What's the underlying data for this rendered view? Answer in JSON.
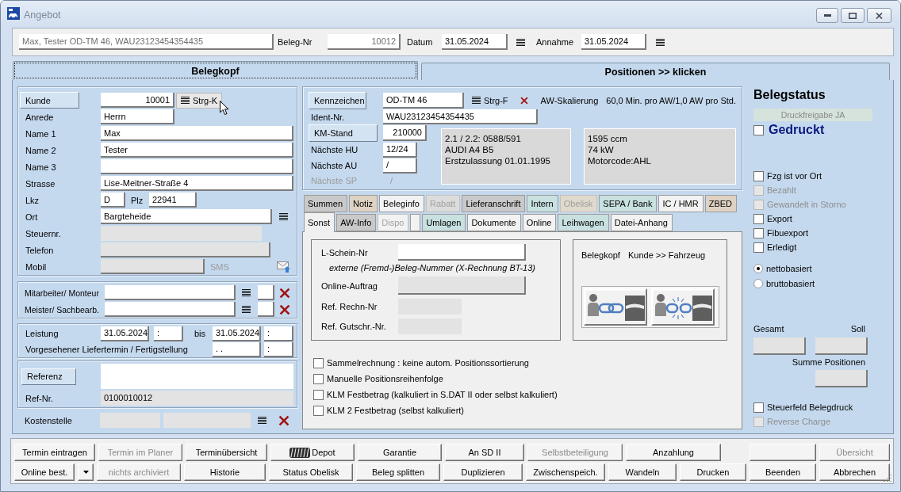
{
  "window": {
    "title": "Angebot"
  },
  "header": {
    "summary": {
      "value": "Max, Tester OD-TM 46, WAU23123454354435",
      "disabled": true
    },
    "beleg_nr": {
      "label": "Beleg-Nr",
      "value": "10012",
      "disabled": true
    },
    "datum": {
      "label": "Datum",
      "value": "31.05.2024"
    },
    "annahme": {
      "label": "Annahme",
      "value": "31.05.2024"
    }
  },
  "main_tabs": [
    {
      "label": "Belegkopf",
      "selected": true
    },
    {
      "label": "Positionen >> klicken",
      "selected": false
    }
  ],
  "customer": {
    "kunde": {
      "button": "Kunde",
      "value": "10001",
      "shortcut": "Strg-K"
    },
    "anrede": {
      "label": "Anrede",
      "value": "Herrn"
    },
    "name_1": {
      "label": "Name 1",
      "value": "Max"
    },
    "name_2": {
      "label": "Name 2",
      "value": "Tester"
    },
    "name_3": {
      "label": "Name 3"
    },
    "strasse": {
      "label": "Strasse",
      "value": "Lise-Meitner-Straße 4"
    },
    "lkz": {
      "label": "Lkz",
      "value": "D"
    },
    "plz": {
      "label": "Plz",
      "value": "22941"
    },
    "ort": {
      "label": "Ort",
      "value": "Bargteheide"
    },
    "steuernr": {
      "label": "Steuernr.",
      "disabled": true
    },
    "telefon": {
      "label": "Telefon",
      "disabled": true
    },
    "mobil": {
      "label": "Mobil",
      "disabled": true,
      "sms": "SMS"
    }
  },
  "staff": [
    {
      "label": "Mitarbeiter/ Monteur"
    },
    {
      "label": "Meister/ Sachbearb."
    }
  ],
  "schedule": {
    "leistung": {
      "label": "Leistung",
      "date": "31.05.2024",
      "time": ":"
    },
    "bis": {
      "label": "bis",
      "date": "31.05.2024",
      "time": ":"
    },
    "liefertermin": {
      "label": "Vorgesehener Liefertermin / Fertigstellung",
      "date": ". .",
      "time": ":"
    }
  },
  "reference": {
    "button": "Referenz",
    "ref_nr": {
      "label": "Ref-Nr.",
      "value": "0100010012",
      "disabled": true
    }
  },
  "kostenstelle": {
    "label": "Kostenstelle",
    "disabled": true
  },
  "vehicle": {
    "kennzeichen": {
      "button": "Kennzeichen",
      "value": "OD-TM 46",
      "shortcut": "Strg-F"
    },
    "aw_skalierung": {
      "label": "AW-Skalierung",
      "value": "60,0 Min. pro AW/1,0 AW pro Std."
    },
    "ident": {
      "label": "Ident-Nr.",
      "value": "WAU23123454354435"
    },
    "km_stand": {
      "button": "KM-Stand",
      "value": "210000"
    },
    "inspections": [
      {
        "label": "Nächste HU",
        "value": "12/24",
        "disabled": false
      },
      {
        "label": "Nächste AU",
        "value": "/",
        "disabled": false
      },
      {
        "label": "Nächste SP",
        "value": "/",
        "disabled": true
      }
    ],
    "type_info": [
      "2.1 / 2.2: 0588/591",
      "AUDI A4 B5",
      "Erstzulassung 01.01.1995"
    ],
    "engine_info": [
      "1595 ccm",
      "74 kW",
      "Motorcode:AHL"
    ]
  },
  "detail_tabs": [
    {
      "tabs": [
        {
          "kind": "text",
          "label": "Summen",
          "selected": false,
          "disabled": false,
          "color": "#c9c9c9"
        },
        {
          "kind": "text",
          "label": "Notiz",
          "selected": false,
          "disabled": false,
          "color": "#ded2c2"
        },
        {
          "kind": "text",
          "label": "Beleginfo",
          "selected": false,
          "disabled": false,
          "color": "#f2f2f2"
        },
        {
          "kind": "text",
          "label": "Rabatt",
          "selected": false,
          "disabled": true,
          "color": "#dcdcdc"
        },
        {
          "kind": "text",
          "label": "Lieferanschrift",
          "selected": false,
          "disabled": false,
          "color": "#c9c9c9"
        },
        {
          "kind": "text",
          "label": "Intern",
          "selected": false,
          "disabled": false,
          "color": "#c8e0e0"
        },
        {
          "kind": "text",
          "label": "Obelisk",
          "selected": false,
          "disabled": true,
          "color": "#e0d9cd"
        },
        {
          "kind": "text",
          "label": "SEPA / Bank",
          "selected": false,
          "disabled": false,
          "color": "#c8e0e0"
        },
        {
          "kind": "text",
          "label": "IC / HMR",
          "selected": false,
          "disabled": false,
          "color": "#f2f2f2"
        },
        {
          "kind": "text",
          "label": "ZBED",
          "selected": false,
          "disabled": false,
          "color": "#ded2c2"
        }
      ]
    },
    {
      "tabs": [
        {
          "kind": "text",
          "label": "Sonst",
          "selected": true,
          "disabled": false,
          "color": "#f0f0f0"
        },
        {
          "kind": "text",
          "label": "AW-Info",
          "selected": false,
          "disabled": false,
          "color": "#c9c9c9"
        },
        {
          "kind": "text",
          "label": "Dispo",
          "selected": false,
          "disabled": true,
          "color": "#f2f2f2"
        },
        {
          "kind": "blank",
          "selected": false,
          "disabled": false,
          "color": "#f2f2f2"
        },
        {
          "kind": "text",
          "label": "Umlagen",
          "selected": false,
          "disabled": false,
          "color": "#c8e0e0"
        },
        {
          "kind": "text",
          "label": "Dokumente",
          "selected": false,
          "disabled": false,
          "color": "#f2f2f2"
        },
        {
          "kind": "text",
          "label": "Online",
          "selected": false,
          "disabled": false,
          "color": "#f2f2f2"
        },
        {
          "kind": "text",
          "label": "Leihwagen",
          "selected": false,
          "disabled": false,
          "color": "#c8e0e0"
        },
        {
          "kind": "text",
          "label": "Datei-Anhang",
          "selected": false,
          "disabled": false,
          "color": "#f2f2f2"
        }
      ]
    }
  ],
  "sonst": {
    "l_schein": {
      "label": "L-Schein-Nr",
      "disabled": false
    },
    "note": "externe (Fremd-)Beleg-Nummer (X-Rechnung BT-13)",
    "online_auftrag": {
      "label": "Online-Auftrag",
      "disabled": true
    },
    "ref_rechn": {
      "label": "Ref. Rechn-Nr",
      "disabled": true
    },
    "ref_gutschr": {
      "label": "Ref. Gutschr.-Nr.",
      "disabled": true
    },
    "link_title": "Belegkopf",
    "link_subtitle": "Kunde >> Fahrzeug",
    "options": [
      {
        "label": "Sammelrechnung : keine autom. Positionssortierung",
        "checked": false
      },
      {
        "label": "Manuelle Positionsreihenfolge",
        "checked": false
      },
      {
        "label": "KLM Festbetrag (kalkuliert in S.DAT II oder selbst kalkuliert)",
        "checked": false
      },
      {
        "label": "KLM 2 Festbetrag (selbst kalkuliert)",
        "checked": false
      }
    ]
  },
  "status": {
    "title": "Belegstatus",
    "druckfreigabe": "Druckfreigabe JA",
    "gedruckt": {
      "label": "Gedruckt",
      "checked": false
    },
    "flags": [
      {
        "label": "Fzg ist vor Ort",
        "checked": false,
        "disabled": false
      },
      {
        "label": "Bezahlt",
        "checked": false,
        "disabled": true
      },
      {
        "label": "Gewandelt in Storno",
        "checked": false,
        "disabled": true
      },
      {
        "label": "Export",
        "checked": false,
        "disabled": false
      },
      {
        "label": "Fibuexport",
        "checked": false,
        "disabled": false
      },
      {
        "label": "Erledigt",
        "checked": false,
        "disabled": false
      }
    ],
    "basis": [
      {
        "label": "nettobasiert",
        "selected": true
      },
      {
        "label": "bruttobasiert",
        "selected": false
      }
    ],
    "gesamt": {
      "label": "Gesamt",
      "disabled": true
    },
    "soll": {
      "label": "Soll",
      "disabled": true
    },
    "summe_positionen": {
      "label": "Summe Positionen",
      "disabled": true
    },
    "print_flags": [
      {
        "label": "Steuerfeld Belegdruck",
        "checked": false,
        "disabled": false
      },
      {
        "label": "Reverse Charge",
        "checked": false,
        "disabled": true
      }
    ]
  },
  "buttons": [
    {
      "items": [
        {
          "kind": "text",
          "label": "Termin eintragen",
          "disabled": false
        },
        {
          "kind": "text",
          "label": "Termin im Planer",
          "disabled": true
        },
        {
          "kind": "text",
          "label": "Terminübersicht",
          "disabled": false
        },
        {
          "kind": "tire",
          "label": "Depot",
          "disabled": false
        },
        {
          "kind": "text",
          "label": "Garantie",
          "disabled": false
        },
        {
          "kind": "text",
          "label": "An SD II",
          "disabled": false
        },
        {
          "kind": "text",
          "label": "Selbstbeteiligung",
          "disabled": true
        },
        {
          "kind": "text",
          "label": "Anzahlung",
          "disabled": false
        },
        {
          "kind": "blank",
          "disabled": false
        },
        {
          "kind": "text",
          "label": "Übersicht",
          "disabled": true
        }
      ]
    },
    {
      "items": [
        {
          "kind": "text",
          "label": "Online best.",
          "disabled": false
        },
        {
          "kind": "dropdown",
          "disabled": false
        },
        {
          "kind": "text",
          "label": "nichts archiviert",
          "disabled": true
        },
        {
          "kind": "text",
          "label": "Historie",
          "disabled": false
        },
        {
          "kind": "text",
          "label": "Status Obelisk",
          "disabled": false
        },
        {
          "kind": "text",
          "label": "Beleg splitten",
          "disabled": false
        },
        {
          "kind": "text",
          "label": "Duplizieren",
          "disabled": false
        },
        {
          "kind": "text",
          "label": "Zwischenspeich.",
          "disabled": false
        },
        {
          "kind": "text",
          "label": "Wandeln",
          "disabled": false
        },
        {
          "kind": "text",
          "label": "Drucken",
          "disabled": false
        },
        {
          "kind": "text",
          "label": "Beenden",
          "disabled": false
        },
        {
          "kind": "text",
          "label": "Abbrechen",
          "disabled": false
        }
      ]
    }
  ]
}
